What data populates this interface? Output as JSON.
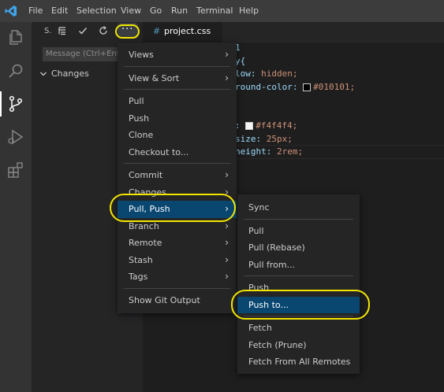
{
  "menubar": [
    "File",
    "Edit",
    "Selection",
    "View",
    "Go",
    "Run",
    "Terminal",
    "Help"
  ],
  "sidebar": {
    "title": "S.",
    "message_placeholder": "Message (Ctrl+Ent",
    "changes_label": "Changes"
  },
  "editor": {
    "tab_label": "project.css",
    "code_lines": [
      {
        "a": "1",
        "b": "",
        "c": ""
      },
      {
        "a": "y{",
        "b": "",
        "c": ""
      },
      {
        "a": "low: ",
        "b": "hidden;",
        "c": ""
      },
      {
        "a": "round-color: ",
        "b": "#010101;",
        "c": "#010101"
      },
      {
        "a": "",
        "b": "",
        "c": ""
      },
      {
        "a": "",
        "b": "",
        "c": ""
      },
      {
        "a": ": ",
        "b": "#f4f4f4;",
        "c": "#f4f4f4"
      },
      {
        "a": "size: ",
        "b": "25px;",
        "c": ""
      },
      {
        "a": "height: ",
        "b": "2rem;",
        "c": ""
      }
    ]
  },
  "main_menu": {
    "groups": [
      [
        {
          "label": "Views",
          "submenu": true
        }
      ],
      [
        {
          "label": "View & Sort",
          "submenu": true
        }
      ],
      [
        {
          "label": "Pull"
        },
        {
          "label": "Push"
        },
        {
          "label": "Clone"
        },
        {
          "label": "Checkout to..."
        }
      ],
      [
        {
          "label": "Commit",
          "submenu": true
        },
        {
          "label": "Changes",
          "submenu": true
        },
        {
          "label": "Pull, Push",
          "submenu": true,
          "selected": true
        },
        {
          "label": "Branch",
          "submenu": true
        },
        {
          "label": "Remote",
          "submenu": true
        },
        {
          "label": "Stash",
          "submenu": true
        },
        {
          "label": "Tags",
          "submenu": true
        }
      ],
      [
        {
          "label": "Show Git Output"
        }
      ]
    ]
  },
  "sub_menu": {
    "groups": [
      [
        {
          "label": "Sync"
        }
      ],
      [
        {
          "label": "Pull"
        },
        {
          "label": "Pull (Rebase)"
        },
        {
          "label": "Pull from..."
        }
      ],
      [
        {
          "label": "Push"
        },
        {
          "label": "Push to...",
          "selected": true
        }
      ],
      [
        {
          "label": "Fetch"
        },
        {
          "label": "Fetch (Prune)"
        },
        {
          "label": "Fetch From All Remotes"
        }
      ]
    ]
  },
  "colors": {
    "accent": "#094771",
    "highlight": "#f2e600",
    "string": "#ce9178",
    "property": "#9cdcfe"
  }
}
